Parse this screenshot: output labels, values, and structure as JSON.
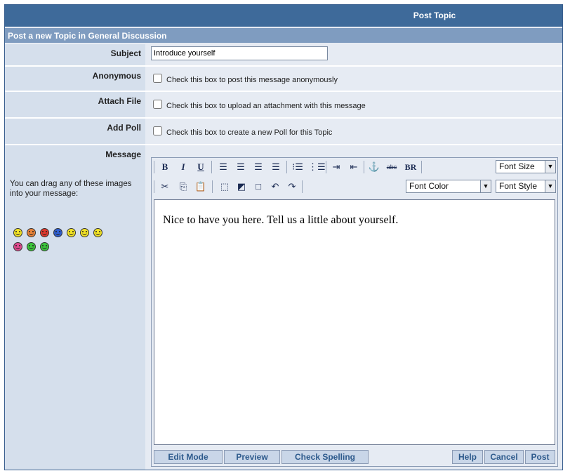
{
  "header": {
    "title": "Post Topic",
    "subtitle": "Post a new Topic in General Discussion"
  },
  "form": {
    "subject": {
      "label": "Subject",
      "value": "Introduce yourself"
    },
    "anonymous": {
      "label": "Anonymous",
      "text": "Check this box to post this message anonymously",
      "checked": false
    },
    "attach": {
      "label": "Attach File",
      "text": "Check this box to upload an attachment with this message",
      "checked": false
    },
    "poll": {
      "label": "Add Poll",
      "text": "Check this box to create a new Poll for this Topic",
      "checked": false
    },
    "message": {
      "label": "Message",
      "body": "Nice to have you here. Tell us a little about yourself."
    }
  },
  "emoticons": {
    "hint": "You can drag any of these images into your message:",
    "items": [
      {
        "name": "smile",
        "color": "#f2e326"
      },
      {
        "name": "confused",
        "color": "#e8833a"
      },
      {
        "name": "angry",
        "color": "#e0382d"
      },
      {
        "name": "sad",
        "color": "#2f5fd0"
      },
      {
        "name": "grin",
        "color": "#f2e326"
      },
      {
        "name": "wink",
        "color": "#f2e326"
      },
      {
        "name": "tongue",
        "color": "#f2e326"
      },
      {
        "name": "embarrassed",
        "color": "#e04a8f"
      },
      {
        "name": "happy-green",
        "color": "#3cc43c"
      },
      {
        "name": "laugh-green",
        "color": "#3cc43c"
      }
    ]
  },
  "toolbar": {
    "row1": {
      "bold": "B",
      "italic": "I",
      "underline": "U",
      "br": "BR",
      "font_size": "Font Size"
    },
    "row2": {
      "font_color": "Font Color",
      "font_style": "Font Style"
    }
  },
  "bottom": {
    "edit_mode": "Edit Mode",
    "preview": "Preview",
    "check_spelling": "Check Spelling",
    "help": "Help",
    "cancel": "Cancel",
    "post": "Post"
  },
  "colors": {
    "title_bar": "#3e6a9a",
    "sub_bar": "#7f9cc0",
    "label_bg": "#d5dfec",
    "body_bg": "#e6ebf3",
    "button_text": "#2d5a8c"
  }
}
